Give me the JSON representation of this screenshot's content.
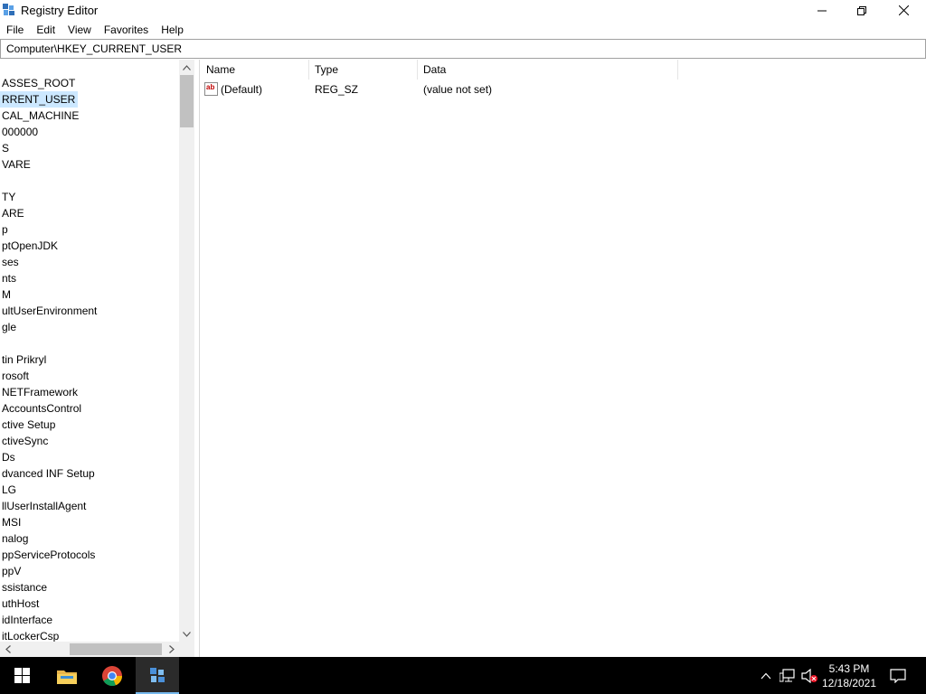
{
  "window": {
    "title": "Registry Editor"
  },
  "menu": [
    "File",
    "Edit",
    "View",
    "Favorites",
    "Help"
  ],
  "address": {
    "path": "Computer\\HKEY_CURRENT_USER"
  },
  "tree": {
    "items": [
      "ASSES_ROOT",
      "RRENT_USER",
      "CAL_MACHINE",
      "000000",
      "S",
      "VARE",
      "",
      "TY",
      "ARE",
      "p",
      "ptOpenJDK",
      "ses",
      "nts",
      "M",
      "ultUserEnvironment",
      "gle",
      "",
      "tin Prikryl",
      "rosoft",
      "NETFramework",
      "AccountsControl",
      "ctive Setup",
      "ctiveSync",
      "Ds",
      "dvanced INF Setup",
      "LG",
      "llUserInstallAgent",
      "MSI",
      "nalog",
      "ppServiceProtocols",
      "ppV",
      "ssistance",
      "uthHost",
      "idInterface",
      "itLockerCsp"
    ],
    "selected_index": 1
  },
  "columns": {
    "name": "Name",
    "type": "Type",
    "data": "Data"
  },
  "values": [
    {
      "icon": "string-value-icon",
      "icon_text": "ab",
      "name": "(Default)",
      "type": "REG_SZ",
      "data": "(value not set)"
    }
  ],
  "taskbar": {
    "apps": [
      "start-icon",
      "file-explorer-icon",
      "chrome-icon",
      "registry-editor-icon"
    ],
    "tray_icons": [
      "chevron-up-icon",
      "network-icon",
      "volume-muted-icon"
    ],
    "time": "5:43 PM",
    "date": "12/18/2021"
  },
  "colors": {
    "selection": "#cce8ff",
    "taskbar": "#000000",
    "taskbar_accent": "#76b9ed"
  }
}
